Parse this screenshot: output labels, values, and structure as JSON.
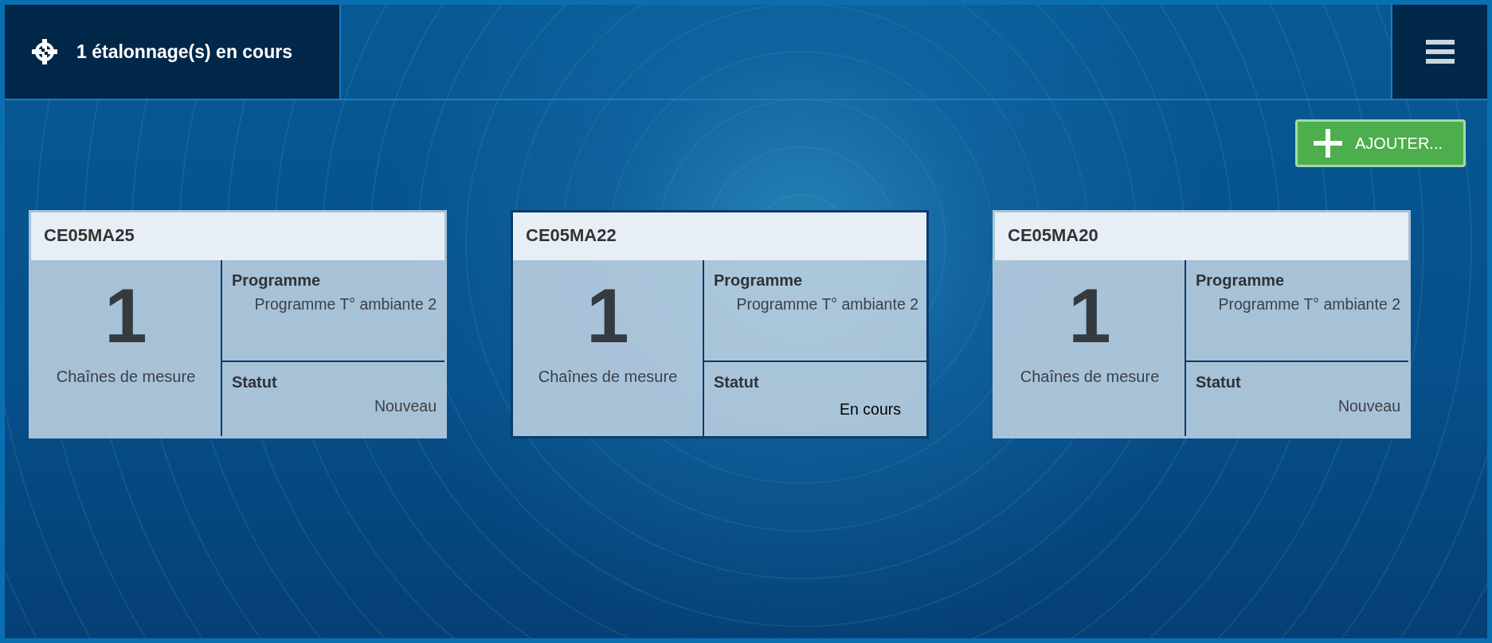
{
  "header": {
    "title": "1 étalonnage(s) en cours"
  },
  "add_button": {
    "label": "AJOUTER..."
  },
  "cards": [
    {
      "title": "CE05MA25",
      "count": "1",
      "count_label": "Chaînes de mesure",
      "program_label": "Programme",
      "program": "Programme T° ambiante 2",
      "status_label": "Statut",
      "status": "Nouveau",
      "active": false
    },
    {
      "title": "CE05MA22",
      "count": "1",
      "count_label": "Chaînes de mesure",
      "program_label": "Programme",
      "program": "Programme T° ambiante 2",
      "status_label": "Statut",
      "status": "En cours",
      "active": true
    },
    {
      "title": "CE05MA20",
      "count": "1",
      "count_label": "Chaînes de mesure",
      "program_label": "Programme",
      "program": "Programme T° ambiante 2",
      "status_label": "Statut",
      "status": "Nouveau",
      "active": false
    }
  ]
}
